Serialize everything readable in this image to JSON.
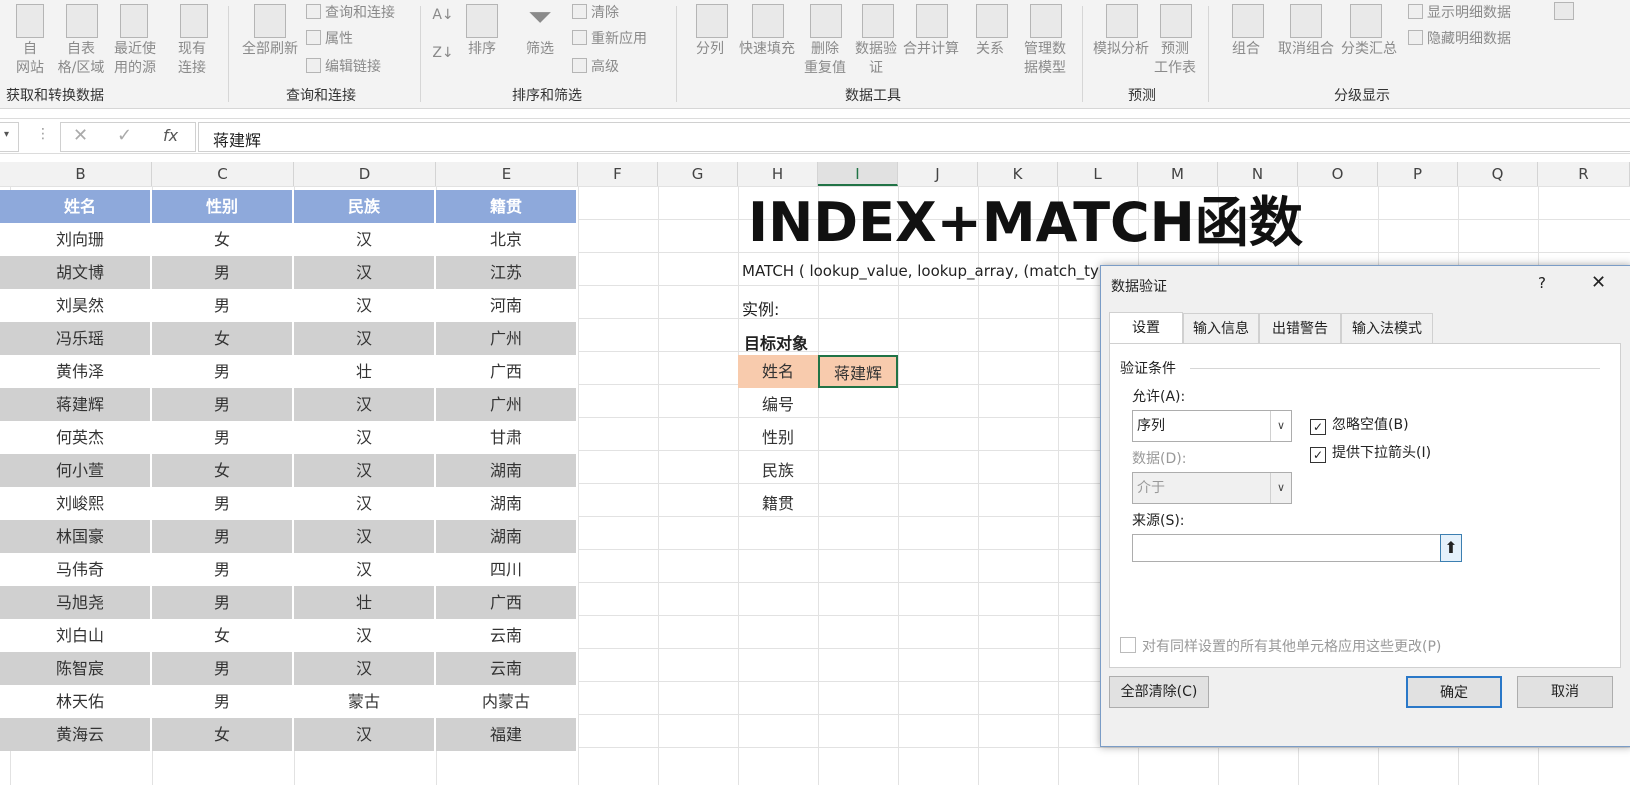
{
  "ribbon": {
    "btn_web": "自\n网站",
    "btn_table": "自表\n格/区域",
    "btn_recent": "最近使\n用的源",
    "btn_existing": "现有\n连接",
    "btn_refresh": "全部刷新",
    "query_conn": "查询和连接",
    "properties": "属性",
    "edit_links": "编辑链接",
    "sort": "排序",
    "filter": "筛选",
    "clear": "清除",
    "reapply": "重新应用",
    "advanced": "高级",
    "split": "分列",
    "flash_fill": "快速填充",
    "remove_dup": "删除\n重复值",
    "data_validation": "数据验\n证",
    "consolidate": "合并计算",
    "relations": "关系",
    "data_model": "管理数\n据模型",
    "whatif": "模拟分析",
    "forecast_sheet": "预测\n工作表",
    "group": "组合",
    "ungroup": "取消组合",
    "subtotal": "分类汇总",
    "show_detail": "显示明细数据",
    "hide_detail": "隐藏明细数据",
    "groups": [
      "获取和转换数据",
      "查询和连接",
      "排序和筛选",
      "数据工具",
      "预测",
      "分级显示"
    ]
  },
  "formula_bar": {
    "value": "蒋建辉",
    "fx": "fx"
  },
  "columns": [
    "B",
    "C",
    "D",
    "E",
    "F",
    "G",
    "H",
    "I",
    "J",
    "K",
    "L",
    "M",
    "N",
    "O",
    "P",
    "Q",
    "R"
  ],
  "table": {
    "headers": [
      "姓名",
      "性别",
      "民族",
      "籍贯"
    ],
    "rows": [
      [
        "刘向珊",
        "女",
        "汉",
        "北京"
      ],
      [
        "胡文博",
        "男",
        "汉",
        "江苏"
      ],
      [
        "刘昊然",
        "男",
        "汉",
        "河南"
      ],
      [
        "冯乐瑶",
        "女",
        "汉",
        "广州"
      ],
      [
        "黄伟泽",
        "男",
        "壮",
        "广西"
      ],
      [
        "蒋建辉",
        "男",
        "汉",
        "广州"
      ],
      [
        "何英杰",
        "男",
        "汉",
        "甘肃"
      ],
      [
        "何小萱",
        "女",
        "汉",
        "湖南"
      ],
      [
        "刘峻熙",
        "男",
        "汉",
        "湖南"
      ],
      [
        "林国豪",
        "男",
        "汉",
        "湖南"
      ],
      [
        "马伟奇",
        "男",
        "汉",
        "四川"
      ],
      [
        "马旭尧",
        "男",
        "壮",
        "广西"
      ],
      [
        "刘白山",
        "女",
        "汉",
        "云南"
      ],
      [
        "陈智宸",
        "男",
        "汉",
        "云南"
      ],
      [
        "林天佑",
        "男",
        "蒙古",
        "内蒙古"
      ],
      [
        "黄海云",
        "女",
        "汉",
        "福建"
      ]
    ]
  },
  "sheet": {
    "title": "INDEX+MATCH函数",
    "syntax": "MATCH ( lookup_value, lookup_array, (match_ty",
    "example_label": "实例:",
    "target_label": "目标对象",
    "lookup_labels": [
      "姓名",
      "编号",
      "性别",
      "民族",
      "籍贯"
    ],
    "selected_value": "蒋建辉"
  },
  "dialog": {
    "title": "数据验证",
    "help": "?",
    "close": "✕",
    "tabs": [
      "设置",
      "输入信息",
      "出错警告",
      "输入法模式"
    ],
    "section": "验证条件",
    "allow_label": "允许(A):",
    "allow_value": "序列",
    "ignore_blank": "忽略空值(B)",
    "dropdown": "提供下拉箭头(I)",
    "data_label": "数据(D):",
    "data_value": "介于",
    "source_label": "来源(S):",
    "source_value": "",
    "apply_all": "对有同样设置的所有其他单元格应用这些更改(P)",
    "clear_all": "全部清除(C)",
    "ok": "确定",
    "cancel": "取消"
  }
}
